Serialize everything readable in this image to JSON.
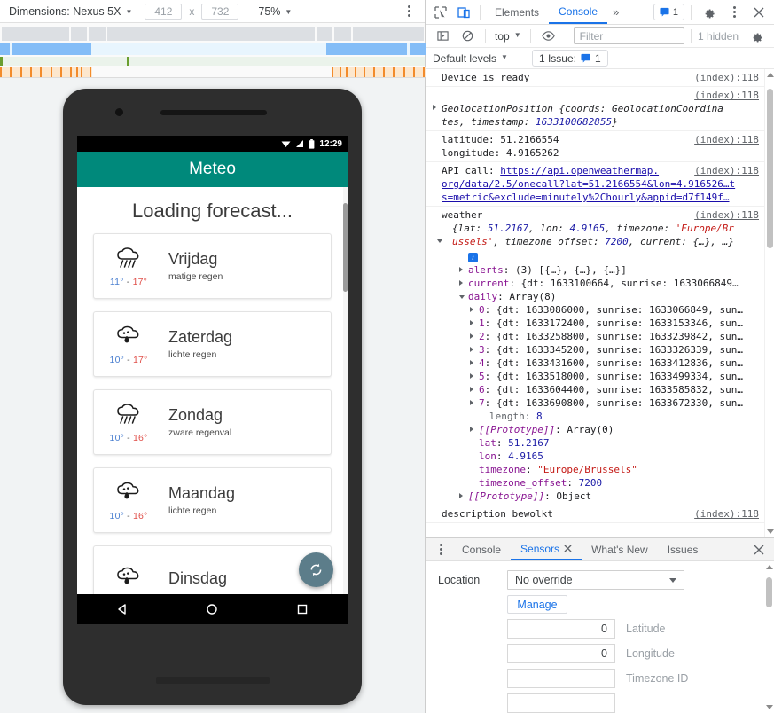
{
  "device_toolbar": {
    "dimensions_label": "Dimensions: Nexus 5X",
    "width_value": "412",
    "x_label": "x",
    "height_value": "732",
    "zoom_label": "75%",
    "menu_icon": "kebab-menu-icon"
  },
  "phone": {
    "status_bar": {
      "time": "12:29",
      "icons": [
        "wifi-icon",
        "signal-icon",
        "battery-icon"
      ]
    },
    "app_title": "Meteo",
    "loading_text": "Loading forecast...",
    "fab_icon": "refresh-icon",
    "nav_icons": [
      "back-triangle-icon",
      "home-circle-icon",
      "recents-square-icon"
    ],
    "forecast": [
      {
        "day": "Vrijdag",
        "min": "11°",
        "sep": "-",
        "max": "17°",
        "desc": "matige regen",
        "icon": "rain-heavy-icon"
      },
      {
        "day": "Zaterdag",
        "min": "10°",
        "sep": "-",
        "max": "17°",
        "desc": "lichte regen",
        "icon": "rain-light-icon"
      },
      {
        "day": "Zondag",
        "min": "10°",
        "sep": "-",
        "max": "16°",
        "desc": "zware regenval",
        "icon": "rain-heavy-icon"
      },
      {
        "day": "Maandag",
        "min": "10°",
        "sep": "-",
        "max": "16°",
        "desc": "lichte regen",
        "icon": "rain-light-icon"
      },
      {
        "day": "Dinsdag",
        "min": "",
        "sep": "",
        "max": "",
        "desc": "",
        "icon": "rain-light-icon"
      }
    ]
  },
  "devtools": {
    "tabs": [
      {
        "label": "Elements",
        "active": false
      },
      {
        "label": "Console",
        "active": true
      }
    ],
    "more_tabs_label": "»",
    "inspect_icon": "inspect-cursor-icon",
    "device_toggle_icon": "device-toolbar-icon",
    "issues_pill": {
      "icon": "issue-message-icon",
      "count": "1"
    },
    "settings_icon": "gear-icon",
    "kebab_icon": "kebab-menu-icon",
    "close_icon": "close-icon",
    "filterbar": {
      "sidebar_icon": "console-sidebar-icon",
      "clear_icon": "clear-console-icon",
      "context": "top",
      "eye_icon": "live-expression-eye-icon",
      "filter_placeholder": "Filter",
      "hidden_label": "1 hidden",
      "settings_icon": "gear-icon"
    },
    "levelbar": {
      "levels_label": "Default levels",
      "issue_label": "1 Issue:",
      "issue_icon": "issue-message-icon",
      "issue_count": "1"
    },
    "console": {
      "source": "(index):118",
      "entries": [
        {
          "kind": "plain",
          "text": "Device is ready"
        },
        {
          "kind": "object_header",
          "text_a": "GeolocationPosition {coords: GeolocationCoordina",
          "text_b": "tes, timestamp: ",
          "num": "1633100682855",
          "text_c": "}"
        },
        {
          "kind": "two_line",
          "line1": "latitude: 51.2166554",
          "line2": "longitude: 4.9165262"
        },
        {
          "kind": "api",
          "prefix": "API call: ",
          "url1": "https://api.openweathermap.",
          "url2": "org/data/2.5/onecall?lat=51.2166554&lon=4.916526…t",
          "url3": "s=metric&exclude=minutely%2Chourly&appid=d7f149f…"
        },
        {
          "kind": "weather",
          "label": "weather",
          "head1_a": "{lat: ",
          "head1_lat": "51.2167",
          "head1_b": ", lon: ",
          "head1_lon": "4.9165",
          "head1_c": ", timezone: ",
          "head1_tz1": "'Europe/Br",
          "head2_tz2": "ussels'",
          "head2_a": ", timezone_offset: ",
          "head2_off": "7200",
          "head2_b": ", current: {…}, …}",
          "badge": "i",
          "rows": [
            {
              "prop": "alerts",
              "rest": ": (3) [{…}, {…}, {…}]",
              "arrow": "closed",
              "indent": 1
            },
            {
              "prop": "current",
              "rest": ": {dt: 1633100664, sunrise: 1633066849…",
              "arrow": "closed",
              "indent": 1
            },
            {
              "prop": "daily",
              "rest": ": Array(8)",
              "arrow": "open",
              "indent": 1
            }
          ],
          "daily": [
            {
              "i": "0",
              "rest": ": {dt: 1633086000, sunrise: 1633066849, sun…"
            },
            {
              "i": "1",
              "rest": ": {dt: 1633172400, sunrise: 1633153346, sun…"
            },
            {
              "i": "2",
              "rest": ": {dt: 1633258800, sunrise: 1633239842, sun…"
            },
            {
              "i": "3",
              "rest": ": {dt: 1633345200, sunrise: 1633326339, sun…"
            },
            {
              "i": "4",
              "rest": ": {dt: 1633431600, sunrise: 1633412836, sun…"
            },
            {
              "i": "5",
              "rest": ": {dt: 1633518000, sunrise: 1633499334, sun…"
            },
            {
              "i": "6",
              "rest": ": {dt: 1633604400, sunrise: 1633585832, sun…"
            },
            {
              "i": "7",
              "rest": ": {dt: 1633690800, sunrise: 1633672330, sun…"
            }
          ],
          "length_label": "length",
          "length_value": "8",
          "proto_array": "[[Prototype]]",
          "proto_array_val": ": Array(0)",
          "lat_key": "lat",
          "lat_val": "51.2167",
          "lon_key": "lon",
          "lon_val": "4.9165",
          "tz_key": "timezone",
          "tz_val": "\"Europe/Brussels\"",
          "tzoff_key": "timezone_offset",
          "tzoff_val": "7200",
          "proto_obj": "[[Prototype]]",
          "proto_obj_val": ": Object"
        },
        {
          "kind": "plain",
          "text": "description bewolkt"
        }
      ]
    },
    "drawer": {
      "kebab_icon": "kebab-menu-icon",
      "tabs": [
        {
          "label": "Console",
          "active": false,
          "closable": false
        },
        {
          "label": "Sensors",
          "active": true,
          "closable": true
        },
        {
          "label": "What's New",
          "active": false,
          "closable": false
        },
        {
          "label": "Issues",
          "active": false,
          "closable": false
        }
      ],
      "close_icon": "close-icon",
      "sensors": {
        "location_label": "Location",
        "override_value": "No override",
        "manage_label": "Manage",
        "fields": [
          {
            "value": "0",
            "label": "Latitude"
          },
          {
            "value": "0",
            "label": "Longitude"
          },
          {
            "value": "",
            "label": "Timezone ID"
          },
          {
            "value": "",
            "label": ""
          }
        ]
      }
    }
  },
  "colors": {
    "accent": "#1a73e8",
    "app_bar": "#00897b",
    "fab": "#5c7d8a",
    "temp_min": "#4a7fd0",
    "temp_max": "#e0504a"
  }
}
